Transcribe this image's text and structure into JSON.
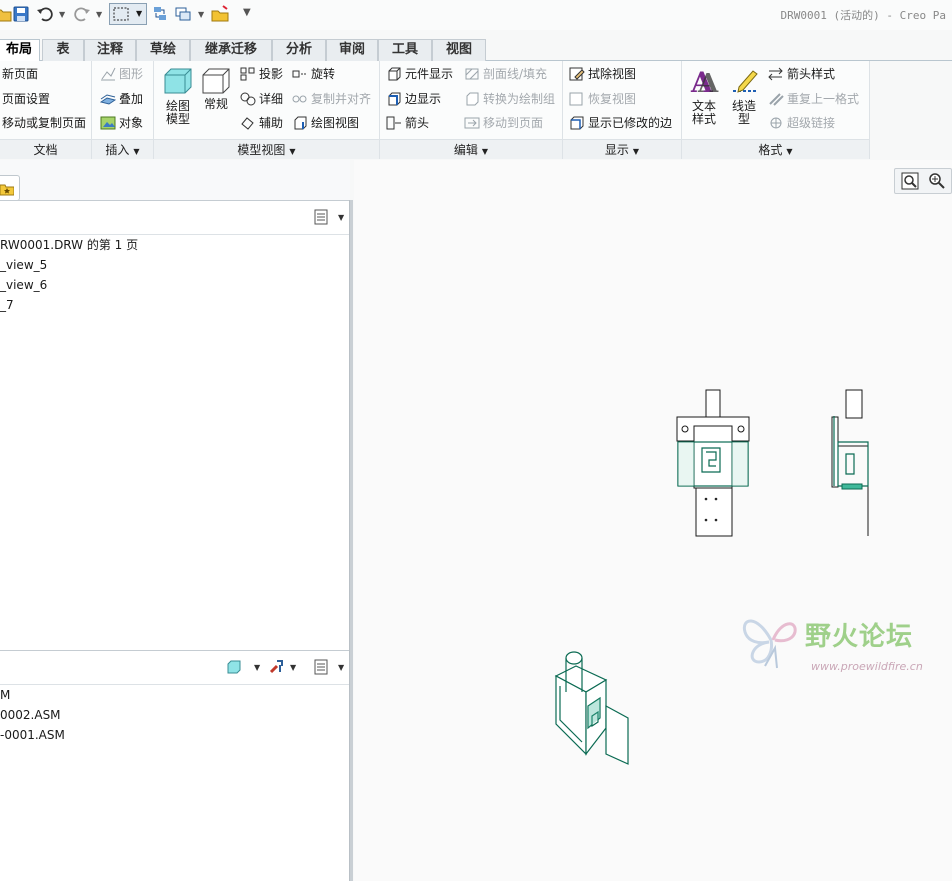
{
  "title_bar": {
    "text": "DRW0001 (活动的) - Creo Pa"
  },
  "ribbon_tabs": [
    {
      "label": "布局",
      "active": true
    },
    {
      "label": "表",
      "active": false
    },
    {
      "label": "注释",
      "active": false
    },
    {
      "label": "草绘",
      "active": false
    },
    {
      "label": "继承迁移",
      "active": false
    },
    {
      "label": "分析",
      "active": false
    },
    {
      "label": "审阅",
      "active": false
    },
    {
      "label": "工具",
      "active": false
    },
    {
      "label": "视图",
      "active": false
    }
  ],
  "ribbon": {
    "document": {
      "label": "文档",
      "items": [
        "新页面",
        "页面设置",
        "移动或复制页面"
      ]
    },
    "insert": {
      "label": "插入",
      "items": [
        "图形",
        "叠加",
        "对象"
      ]
    },
    "model_views": {
      "label": "模型视图",
      "big": [
        "绘图模型",
        "常规"
      ],
      "col1": [
        "投影",
        "详细",
        "辅助"
      ],
      "col2": [
        "旋转",
        "复制并对齐",
        "绘图视图"
      ]
    },
    "edit": {
      "label": "编辑",
      "col1": [
        "元件显示",
        "边显示",
        "箭头"
      ],
      "col2": [
        "剖面线/填充",
        "转换为绘制组",
        "移动到页面"
      ]
    },
    "display": {
      "label": "显示",
      "items": [
        "拭除视图",
        "恢复视图",
        "显示已修改的边"
      ]
    },
    "format": {
      "label": "格式",
      "big": [
        "文本样式",
        "线造型"
      ],
      "items": [
        "箭头样式",
        "重复上一格式",
        "超级链接"
      ]
    }
  },
  "drawing_tree": {
    "rows": [
      "RW0001.DRW 的第 1 页",
      "_view_5",
      "_view_6",
      "_7"
    ]
  },
  "model_tree": {
    "rows": [
      "M",
      "0002.ASM",
      "-0001.ASM"
    ]
  },
  "watermark": {
    "brand": "野火论坛",
    "url": "www.proewildfire.cn"
  },
  "colors": {
    "accent_tab": "#ffffff",
    "model_line": "#0b6b53",
    "model_fill": "#3fb89a"
  }
}
